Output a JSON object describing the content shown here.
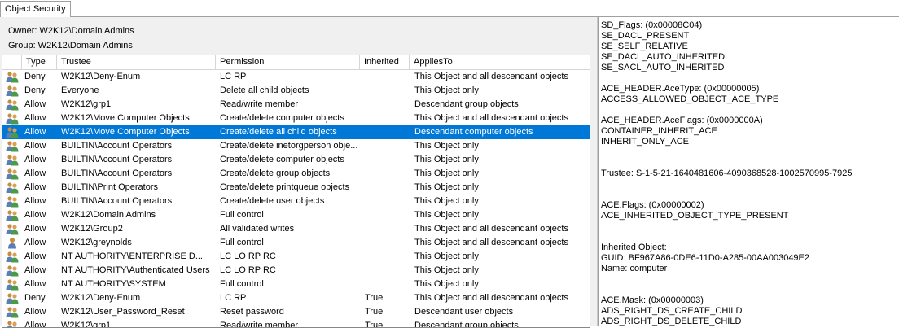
{
  "tab": {
    "label": "Object Security"
  },
  "owner": "Owner:  W2K12\\Domain Admins",
  "group": "Group:  W2K12\\Domain Admins",
  "columns": {
    "type": "Type",
    "trustee": "Trustee",
    "permission": "Permission",
    "inherited": "Inherited",
    "applies_to": "AppliesTo"
  },
  "colors": {
    "selection": "#0078d7",
    "panel": "#f0f0f0"
  },
  "rows": [
    {
      "icon": "group-icon",
      "type": "Deny",
      "trustee": "W2K12\\Deny-Enum",
      "permission": "LC RP",
      "inherited": "",
      "applies_to": "This Object and all descendant objects"
    },
    {
      "icon": "group-icon",
      "type": "Deny",
      "trustee": "Everyone",
      "permission": "Delete all child objects",
      "inherited": "",
      "applies_to": "This Object only"
    },
    {
      "icon": "group-icon",
      "type": "Allow",
      "trustee": "W2K12\\grp1",
      "permission": "Read/write member",
      "inherited": "",
      "applies_to": "Descendant group objects"
    },
    {
      "icon": "group-icon",
      "type": "Allow",
      "trustee": "W2K12\\Move Computer Objects",
      "permission": "Create/delete computer objects",
      "inherited": "",
      "applies_to": "This Object and all descendant objects"
    },
    {
      "icon": "group-icon",
      "type": "Allow",
      "trustee": "W2K12\\Move Computer Objects",
      "permission": "Create/delete all child objects",
      "inherited": "",
      "applies_to": "Descendant computer objects",
      "selected": true
    },
    {
      "icon": "group-icon",
      "type": "Allow",
      "trustee": "BUILTIN\\Account Operators",
      "permission": "Create/delete inetorgperson obje...",
      "inherited": "",
      "applies_to": "This Object only"
    },
    {
      "icon": "group-icon",
      "type": "Allow",
      "trustee": "BUILTIN\\Account Operators",
      "permission": "Create/delete computer objects",
      "inherited": "",
      "applies_to": "This Object only"
    },
    {
      "icon": "group-icon",
      "type": "Allow",
      "trustee": "BUILTIN\\Account Operators",
      "permission": "Create/delete group objects",
      "inherited": "",
      "applies_to": "This Object only"
    },
    {
      "icon": "group-icon",
      "type": "Allow",
      "trustee": "BUILTIN\\Print Operators",
      "permission": "Create/delete printqueue objects",
      "inherited": "",
      "applies_to": "This Object only"
    },
    {
      "icon": "group-icon",
      "type": "Allow",
      "trustee": "BUILTIN\\Account Operators",
      "permission": "Create/delete user objects",
      "inherited": "",
      "applies_to": "This Object only"
    },
    {
      "icon": "group-icon",
      "type": "Allow",
      "trustee": "W2K12\\Domain Admins",
      "permission": "Full control",
      "inherited": "",
      "applies_to": "This Object only"
    },
    {
      "icon": "group-icon",
      "type": "Allow",
      "trustee": "W2K12\\Group2",
      "permission": "All validated writes",
      "inherited": "",
      "applies_to": "This Object and all descendant objects"
    },
    {
      "icon": "user-icon",
      "type": "Allow",
      "trustee": "W2K12\\greynolds",
      "permission": "Full control",
      "inherited": "",
      "applies_to": "This Object and all descendant objects"
    },
    {
      "icon": "group-icon",
      "type": "Allow",
      "trustee": "NT AUTHORITY\\ENTERPRISE D...",
      "permission": "LC LO RP RC",
      "inherited": "",
      "applies_to": "This Object only"
    },
    {
      "icon": "group-icon",
      "type": "Allow",
      "trustee": "NT AUTHORITY\\Authenticated Users",
      "permission": "LC LO RP RC",
      "inherited": "",
      "applies_to": "This Object only"
    },
    {
      "icon": "group-icon",
      "type": "Allow",
      "trustee": "NT AUTHORITY\\SYSTEM",
      "permission": "Full control",
      "inherited": "",
      "applies_to": "This Object only"
    },
    {
      "icon": "group-icon",
      "type": "Deny",
      "trustee": "W2K12\\Deny-Enum",
      "permission": "LC RP",
      "inherited": "True",
      "applies_to": "This Object and all descendant objects"
    },
    {
      "icon": "group-icon",
      "type": "Allow",
      "trustee": "W2K12\\User_Password_Reset",
      "permission": "Reset password",
      "inherited": "True",
      "applies_to": "Descendant user objects"
    },
    {
      "icon": "group-icon",
      "type": "Allow",
      "trustee": "W2K12\\grp1",
      "permission": "Read/write member",
      "inherited": "True",
      "applies_to": "Descendant group objects"
    }
  ],
  "details": {
    "text": "SD_Flags: (0x00008C04)\nSE_DACL_PRESENT\nSE_SELF_RELATIVE\nSE_DACL_AUTO_INHERITED\nSE_SACL_AUTO_INHERITED\n\nACE_HEADER.AceType: (0x00000005)\nACCESS_ALLOWED_OBJECT_ACE_TYPE\n\nACE_HEADER.AceFlags: (0x0000000A)\nCONTAINER_INHERIT_ACE\nINHERIT_ONLY_ACE\n\n\nTrustee: S-1-5-21-1640481606-4090368528-1002570995-7925\n\n\nACE.Flags: (0x00000002)\nACE_INHERITED_OBJECT_TYPE_PRESENT\n\n\nInherited Object:\nGUID: BF967A86-0DE6-11D0-A285-00AA003049E2\nName: computer\n\n\nACE.Mask: (0x00000003)\nADS_RIGHT_DS_CREATE_CHILD\nADS_RIGHT_DS_DELETE_CHILD"
  }
}
